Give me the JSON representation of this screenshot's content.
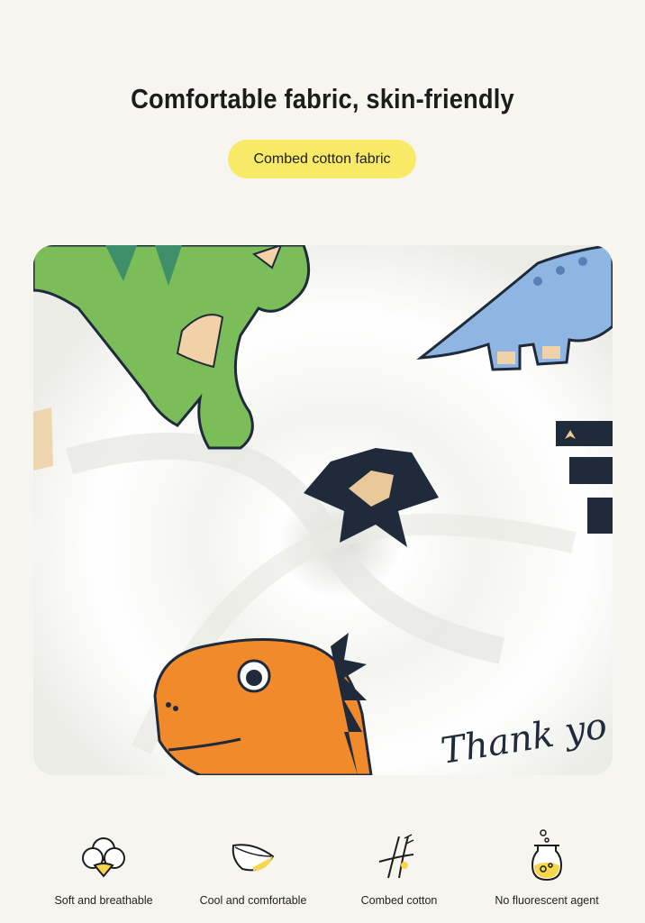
{
  "header": {
    "title": "Comfortable fabric, skin-friendly",
    "badge": "Combed cotton fabric"
  },
  "photo": {
    "subject": "close-up of white cotton fabric printed with cartoon dinosaurs and stars",
    "printed_text": "Thank yo"
  },
  "features": [
    {
      "icon": "cotton-flower-icon",
      "label": "Soft and breathable"
    },
    {
      "icon": "leaf-icon",
      "label": "Cool and comfortable"
    },
    {
      "icon": "combed-cotton-icon",
      "label": "Combed cotton"
    },
    {
      "icon": "flask-icon",
      "label": "No fluorescent agent"
    }
  ],
  "colors": {
    "background": "#f7f5ef",
    "badge": "#f8e967",
    "accent_yellow": "#f6d64a",
    "outline": "#1c1c1c"
  }
}
